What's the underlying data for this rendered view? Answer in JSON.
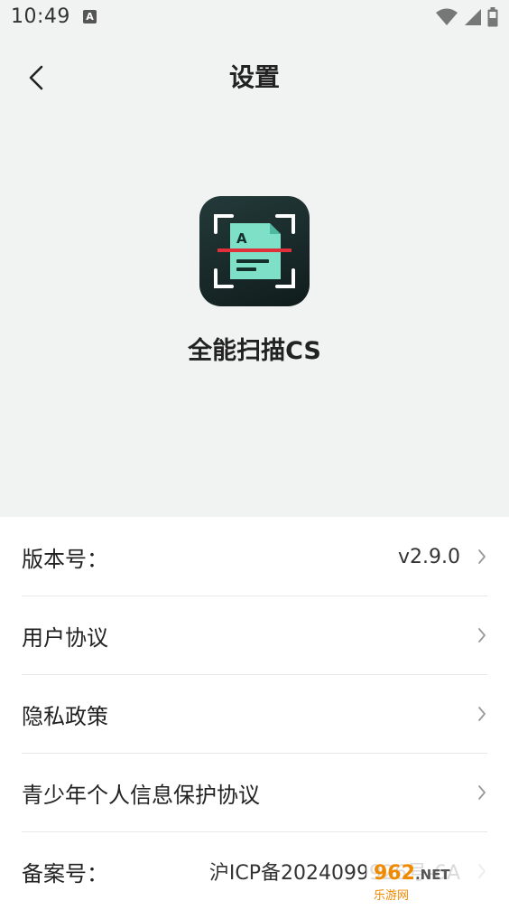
{
  "status_bar": {
    "time": "10:49",
    "notification_icon_letter": "A",
    "icons": [
      "wifi-icon",
      "cellular-signal-icon",
      "battery-icon"
    ]
  },
  "header": {
    "title": "设置",
    "back_icon": "chevron-left-icon"
  },
  "app": {
    "name": "全能扫描CS",
    "logo_letter": "A",
    "logo_colors": {
      "background": "#1a2a2a",
      "document": "#7fe0c8",
      "scan_line": "#e0303a",
      "frame": "#ffffff"
    }
  },
  "settings": {
    "items": [
      {
        "label": "版本号：",
        "value": "v2.9.0"
      },
      {
        "label": "用户协议",
        "value": ""
      },
      {
        "label": "隐私政策",
        "value": ""
      },
      {
        "label": "青少年个人信息保护协议",
        "value": ""
      },
      {
        "label": "备案号：",
        "value": "沪ICP备2024099926号-6A"
      }
    ]
  },
  "watermark": {
    "main": "962",
    "suffix": ".NET",
    "sub": "乐游网"
  },
  "colors": {
    "top_background": "#f1f2f2",
    "list_background": "#ffffff",
    "divider": "#e8e8e8",
    "chevron": "#999999"
  }
}
